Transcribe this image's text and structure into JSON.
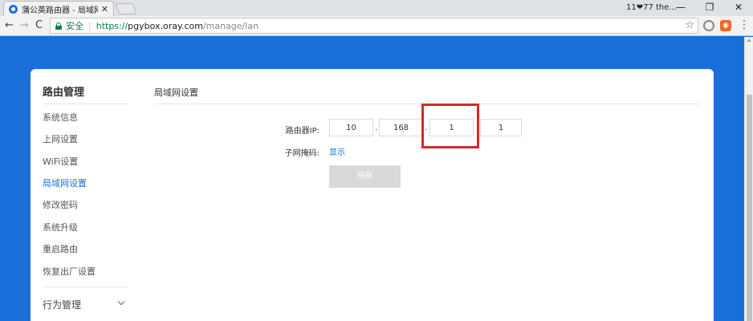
{
  "browser": {
    "tab_title": "蒲公英路由器 - 局域网设",
    "tab_close": "✕",
    "user_label": "11❤77 the...",
    "win_min": "—",
    "win_restore": "❐",
    "win_close": "✕",
    "back": "←",
    "forward": "→",
    "reload": "C",
    "secure_label": "安全",
    "url_scheme": "https://",
    "url_host": "pgybox.oray.com",
    "url_path": "/manage/lan",
    "star": "☆",
    "menu": "⋮"
  },
  "sidebar": {
    "title": "路由管理",
    "items": [
      {
        "label": "系统信息"
      },
      {
        "label": "上网设置"
      },
      {
        "label": "WiFi设置"
      },
      {
        "label": "局域网设置"
      },
      {
        "label": "修改密码"
      },
      {
        "label": "系统升级"
      },
      {
        "label": "重启路由"
      },
      {
        "label": "恢复出厂设置"
      }
    ],
    "group": "行为管理"
  },
  "main": {
    "title": "局域网设置",
    "router_ip_label": "路由器IP:",
    "ip": [
      "10",
      "168",
      "1",
      "1"
    ],
    "dot": ".",
    "subnet_label": "子网掩码:",
    "show_link": "显示",
    "save_button": "保存"
  },
  "colors": {
    "brand": "#1a6fd8",
    "highlight": "#d22a2a",
    "secure": "#0b8043"
  }
}
